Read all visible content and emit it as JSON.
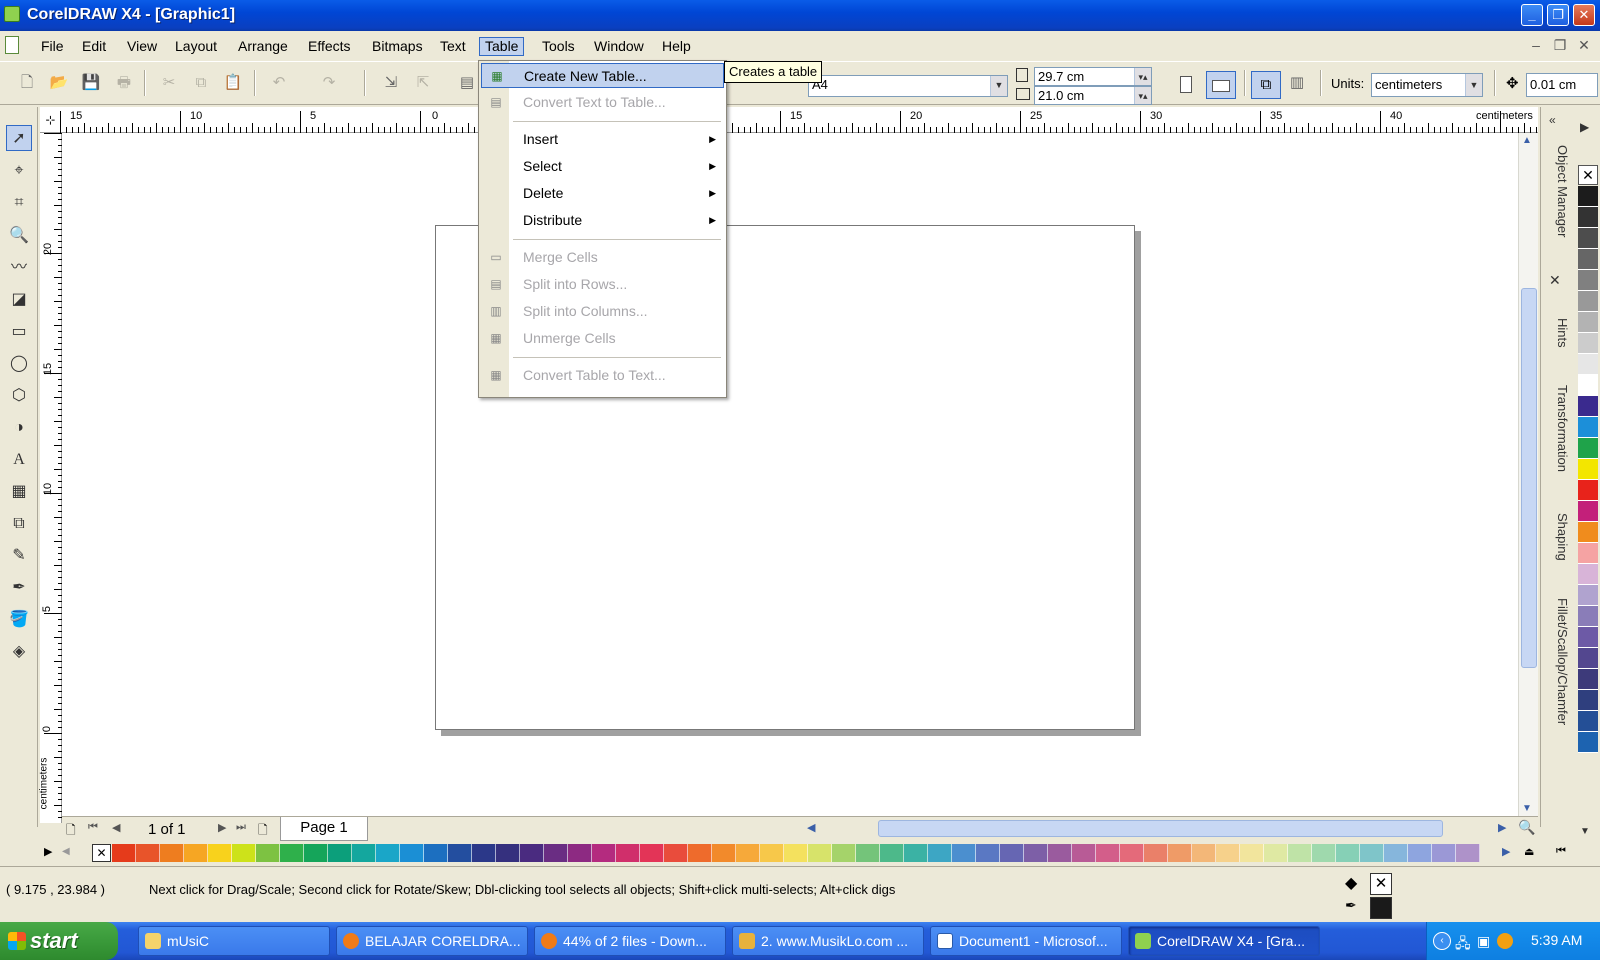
{
  "window": {
    "title": "CorelDRAW X4 - [Graphic1]"
  },
  "menubar": {
    "items": [
      "File",
      "Edit",
      "View",
      "Layout",
      "Arrange",
      "Effects",
      "Bitmaps",
      "Text",
      "Table",
      "Tools",
      "Window",
      "Help"
    ],
    "active": "Table"
  },
  "table_menu": {
    "items": [
      {
        "label": "Create New Table...",
        "enabled": true,
        "highlighted": true,
        "icon": "table-icon"
      },
      {
        "label": "Convert Text to Table...",
        "enabled": false,
        "icon": "text-to-table-icon"
      },
      {
        "label": "Insert",
        "enabled": true,
        "submenu": true
      },
      {
        "label": "Select",
        "enabled": true,
        "submenu": true
      },
      {
        "label": "Delete",
        "enabled": true,
        "submenu": true
      },
      {
        "label": "Distribute",
        "enabled": true,
        "submenu": true
      },
      {
        "label": "Merge Cells",
        "enabled": false,
        "icon": "merge-cells-icon"
      },
      {
        "label": "Split into Rows...",
        "enabled": false,
        "icon": "split-rows-icon"
      },
      {
        "label": "Split into Columns...",
        "enabled": false,
        "icon": "split-columns-icon"
      },
      {
        "label": "Unmerge Cells",
        "enabled": false,
        "icon": "unmerge-cells-icon"
      },
      {
        "label": "Convert Table to Text...",
        "enabled": false,
        "icon": "table-to-text-icon"
      }
    ],
    "tooltip": "Creates a table"
  },
  "property_bar": {
    "paper_size": "A4",
    "width": "29.7 cm",
    "height": "21.0 cm",
    "units_label": "Units:",
    "units_value": "centimeters",
    "nudge": "0.01 cm"
  },
  "ruler": {
    "h_ticks": [
      "15",
      "10",
      "5",
      "0",
      "15",
      "20",
      "25",
      "30",
      "35",
      "40"
    ],
    "h_unit": "centimeters",
    "v_ticks": [
      "20",
      "15",
      "10",
      "5",
      "0"
    ],
    "v_unit": "centimeters"
  },
  "page_nav": {
    "counter": "1 of 1",
    "tab": "Page 1"
  },
  "dockers": [
    "Object Manager",
    "Hints",
    "Transformation",
    "Shaping",
    "Fillet/Scallop/Chamfer"
  ],
  "status": {
    "coords": "( 9.175 , 23.984 )",
    "message": "Next click for Drag/Scale; Second click for Rotate/Skew; Dbl-clicking tool selects all objects; Shift+click multi-selects; Alt+click digs"
  },
  "taskbar": {
    "start": "start",
    "tasks": [
      "mUsiC",
      "BELAJAR CORELDRA...",
      "44% of 2 files - Down...",
      "2. www.MusikLo.com ...",
      "Document1 - Microsof...",
      "CorelDRAW X4 - [Gra..."
    ],
    "active_task": "CorelDRAW X4 - [Gra...",
    "clock": "5:39 AM"
  },
  "palette_colors": [
    "#e53b1b",
    "#e8542a",
    "#ee7d1f",
    "#f6a623",
    "#f8d21c",
    "#cde21a",
    "#7dc242",
    "#2fb04b",
    "#15a55a",
    "#0c9f7b",
    "#14a79e",
    "#1aa6c8",
    "#1b8fd5",
    "#1c6fc0",
    "#234e9f",
    "#2b3889",
    "#35307e",
    "#4a2b80",
    "#6a2d83",
    "#8d2a82",
    "#b42b7f",
    "#d02f6b",
    "#e33457",
    "#e94c3c",
    "#ee6b2c",
    "#f28a2b",
    "#f6a93a",
    "#f7c84a",
    "#f4e15e",
    "#d7e36a",
    "#a5d36a",
    "#74c47a",
    "#4db98a",
    "#3bb2a4",
    "#3da6c4",
    "#4b8fcf",
    "#5a78c3",
    "#6666b3",
    "#7d5fa7",
    "#9a5b9e",
    "#b85b96",
    "#d35e8a",
    "#e46a7a",
    "#ea8069",
    "#ef9b67",
    "#f3b778",
    "#f6d18b",
    "#f2e59d",
    "#dfe9a3",
    "#bfe3a7",
    "#9fd9ad",
    "#86d0b6",
    "#7fc5c9",
    "#86b6dc",
    "#8ea5df",
    "#9b98d6",
    "#ae92c9"
  ],
  "right_palette": [
    "#1c1c1c",
    "#333333",
    "#4d4d4d",
    "#666666",
    "#808080",
    "#999999",
    "#b3b3b3",
    "#cccccc",
    "#e6e6e6",
    "#ffffff",
    "#3a2a8e",
    "#1c8fd9",
    "#1fa34a",
    "#f3e600",
    "#e8231b",
    "#c3207a",
    "#f08c1d",
    "#f5a3a3",
    "#d8b4d8",
    "#b0a3cf",
    "#8a7db8",
    "#6d5aa6",
    "#53478f",
    "#3d3a7a",
    "#2f3f7e",
    "#244f96",
    "#1d63b0"
  ]
}
